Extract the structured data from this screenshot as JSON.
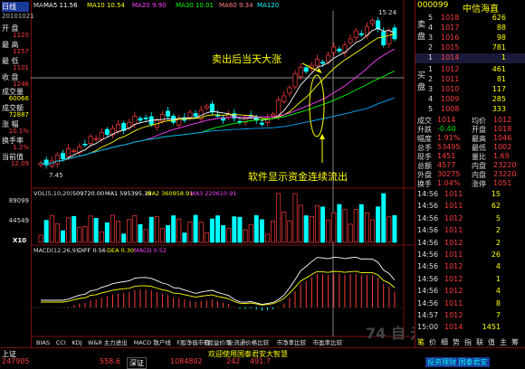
{
  "header": {
    "sym_name": "中信海直",
    "ma_label": "MA",
    "ma5": "MA5 11.56",
    "ma10": "MA10 10.54",
    "ma20": "MA20 9.90",
    "ma30": "MA30 10.01",
    "ma60": "MA60 9.34",
    "ma120": "MA120"
  },
  "sidebar": {
    "date_label": "日线",
    "date_value": "20101021",
    "items": [
      {
        "label": "开 盘",
        "value": "1120"
      },
      {
        "label": "最 高",
        "value": "1257"
      },
      {
        "label": "最 低",
        "value": "1101"
      },
      {
        "label": "收 盘",
        "value": "1246"
      },
      {
        "label": "成交量",
        "value": "60066"
      },
      {
        "label": "成交额",
        "value": "72887"
      },
      {
        "label": "涨 幅",
        "value": "10.1%"
      },
      {
        "label": "换手率",
        "value": "1.2%"
      },
      {
        "label": "当前值",
        "value": "12.09"
      }
    ]
  },
  "annotations": {
    "top_note": "卖出后当天大涨",
    "bottom_note": "软件显示资金连续流出",
    "price_peak": "15.24",
    "price_low": "7.45"
  },
  "volume_panel": {
    "title": "VOL(5,10,20)",
    "vol": "509720.00",
    "ma1": "MA1 595395.19",
    "ma2": "MA2 360958.91",
    "ma3": "MA3 220610.91",
    "scale_top": "89099",
    "scale_mid": "44549",
    "unit": "X10"
  },
  "macd_panel": {
    "title": "MACD(12,26,9)",
    "diff": "DIFF 0.56",
    "dea": "DEA 0.30",
    "macd": "MACD 0.52"
  },
  "indicator_tabs": [
    "BIAS",
    "CCI",
    "KDJ",
    "W&R",
    "主力进出",
    "MACD",
    "散户线",
    "F股净值市值",
    "F股益价率",
    "全流通价格比较",
    "市净率比较",
    "市盈率比较"
  ],
  "quote": {
    "code": "000099",
    "name": "中信海直",
    "sell_label": "卖 盘",
    "buy_label": "买 盘",
    "sells": [
      {
        "lvl": "5",
        "price": "1018",
        "vol": "626"
      },
      {
        "lvl": "4",
        "price": "1017",
        "vol": "88"
      },
      {
        "lvl": "3",
        "price": "1016",
        "vol": "98"
      },
      {
        "lvl": "2",
        "price": "1015",
        "vol": "781"
      },
      {
        "lvl": "1",
        "price": "1014",
        "vol": "1"
      }
    ],
    "buys": [
      {
        "lvl": "1",
        "price": "1012",
        "vol": "461"
      },
      {
        "lvl": "2",
        "price": "1011",
        "vol": "81"
      },
      {
        "lvl": "3",
        "price": "1010",
        "vol": "117"
      },
      {
        "lvl": "4",
        "price": "1009",
        "vol": "285"
      },
      {
        "lvl": "5",
        "price": "1008",
        "vol": "333"
      }
    ],
    "stats": [
      {
        "k": "成交",
        "v": "1014",
        "k2": "均价",
        "v2": "1012"
      },
      {
        "k": "升跌",
        "v": "-0.40",
        "k2": "开盘",
        "v2": "1018"
      },
      {
        "k": "幅度",
        "v": "1.91%",
        "k2": "最高",
        "v2": "1046"
      },
      {
        "k": "总手",
        "v": "53495",
        "k2": "最低",
        "v2": "1002"
      },
      {
        "k": "现手",
        "v": "1451",
        "k2": "量比",
        "v2": "1.69"
      },
      {
        "k": "总额",
        "v": "4577",
        "k2": "内盘",
        "v2": "23220"
      },
      {
        "k": "外盘",
        "v": "30275",
        "k2": "内盘",
        "v2": "23220"
      },
      {
        "k": "换手",
        "v": "1.04%",
        "k2": "涨停",
        "v2": "1051"
      }
    ],
    "ticks": [
      {
        "t": "14:56",
        "p": "1011",
        "v": "15"
      },
      {
        "t": "14:56",
        "p": "1011",
        "v": "62"
      },
      {
        "t": "14:56",
        "p": "1012",
        "v": "5"
      },
      {
        "t": "14:56",
        "p": "1011",
        "v": "2"
      },
      {
        "t": "14:56",
        "p": "1012",
        "v": "2"
      },
      {
        "t": "14:56",
        "p": "1011",
        "v": "26"
      },
      {
        "t": "14:56",
        "p": "1012",
        "v": "4"
      },
      {
        "t": "14:56",
        "p": "1012",
        "v": "1"
      },
      {
        "t": "14:56",
        "p": "1012",
        "v": "4"
      },
      {
        "t": "14:56",
        "p": "1011",
        "v": "8"
      },
      {
        "t": "14:57",
        "p": "1012",
        "v": "7"
      },
      {
        "t": "15:00",
        "p": "1014",
        "v": "1451"
      }
    ],
    "bottom_tabs": [
      "笔",
      "价",
      "细",
      "势",
      "指",
      "联",
      "值",
      "主",
      "筹"
    ]
  },
  "status_bar": {
    "idx1_name": "上证",
    "idx1_val": "247905",
    "idx2_val": "558.6",
    "idx2_name": "深证",
    "idx3_val": "1084802",
    "idx4_val": "242",
    "idx5_val": "491.7",
    "news": "欢迎使用国泰君安大智慧",
    "right_tab": "投资理财 国泰君安"
  },
  "watermark": "74 自 元 景",
  "chart_data": {
    "type": "candlestick",
    "closes": [
      8.1,
      8.0,
      8.2,
      8.5,
      8.3,
      8.8,
      8.7,
      8.9,
      9.0,
      9.4,
      9.3,
      9.6,
      9.5,
      9.8,
      10.0,
      9.7,
      10.1,
      10.4,
      10.2,
      10.3,
      10.0,
      10.2,
      10.5,
      10.4,
      10.1,
      10.3,
      10.2,
      10.6,
      10.4,
      10.7,
      10.9,
      10.6,
      10.4,
      10.2,
      10.5,
      10.3,
      10.1,
      10.3,
      10.4,
      10.2,
      10.0,
      10.3,
      10.5,
      11.2,
      11.4,
      11.8,
      12.5,
      12.8,
      12.6,
      12.9,
      13.2,
      13.0,
      13.4,
      13.8,
      13.6,
      13.9,
      14.2,
      14.6,
      14.4,
      14.8,
      15.1,
      14.7,
      13.9,
      14.6,
      14.2
    ]
  }
}
